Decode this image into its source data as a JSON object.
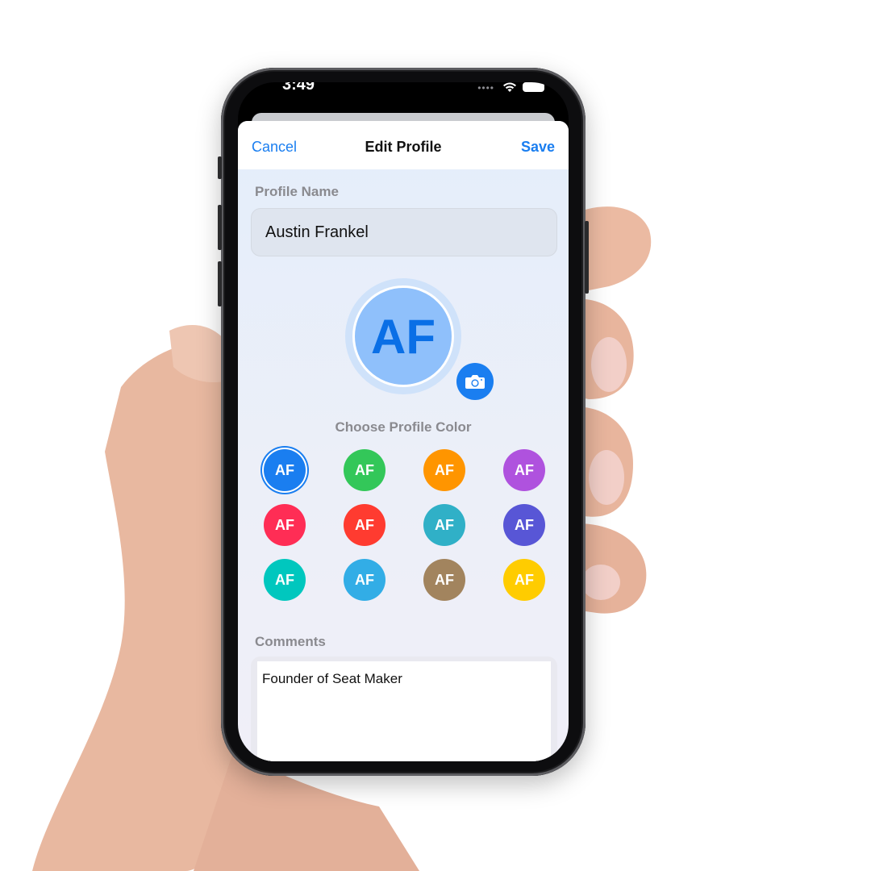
{
  "status_bar": {
    "time": "3:49"
  },
  "nav": {
    "cancel": "Cancel",
    "title": "Edit Profile",
    "save": "Save"
  },
  "profile_name": {
    "label": "Profile Name",
    "value": "Austin Frankel"
  },
  "avatar": {
    "initials": "AF",
    "color": "#8fc0fb",
    "text_color": "#0a6fe6"
  },
  "color_picker": {
    "label": "Choose Profile Color",
    "selected_index": 0,
    "swatches": [
      {
        "initials": "AF",
        "color": "#1a7ef0"
      },
      {
        "initials": "AF",
        "color": "#33c759"
      },
      {
        "initials": "AF",
        "color": "#ff9500"
      },
      {
        "initials": "AF",
        "color": "#af52de"
      },
      {
        "initials": "AF",
        "color": "#ff2d55"
      },
      {
        "initials": "AF",
        "color": "#ff3b30"
      },
      {
        "initials": "AF",
        "color": "#30b0c7"
      },
      {
        "initials": "AF",
        "color": "#5856d6"
      },
      {
        "initials": "AF",
        "color": "#00c7be"
      },
      {
        "initials": "AF",
        "color": "#32ade6"
      },
      {
        "initials": "AF",
        "color": "#a2845e"
      },
      {
        "initials": "AF",
        "color": "#ffcc00"
      }
    ]
  },
  "comments": {
    "label": "Comments",
    "value": "Founder of Seat Maker"
  },
  "icons": {
    "camera": "camera-icon",
    "wifi": "wifi-icon",
    "battery": "battery-icon"
  }
}
